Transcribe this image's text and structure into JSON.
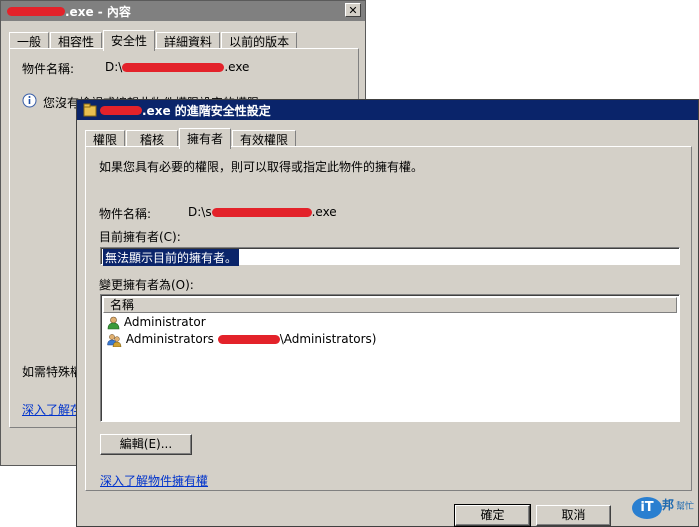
{
  "back_window": {
    "title": ".exe - 內容",
    "tabs": [
      "一般",
      "相容性",
      "安全性",
      "詳細資料",
      "以前的版本"
    ],
    "object_name_label": "物件名稱:",
    "object_name_prefix": "D:\\",
    "object_name_suffix": ".exe",
    "info_text": "您沒有檢視或編輯此物件權限設定的權限",
    "special_perms_text": "如需特殊權",
    "learn_more_link": "深入了解存"
  },
  "front_window": {
    "title": ".exe 的進階安全性設定",
    "tabs": [
      "權限",
      "稽核",
      "擁有者",
      "有效權限"
    ],
    "description": "如果您具有必要的權限，則可以取得或指定此物件的擁有權。",
    "object_name_label": "物件名稱:",
    "object_name_prefix": "D:\\s",
    "object_name_suffix": ".exe",
    "current_owner_label": "目前擁有者(C):",
    "current_owner_value": "無法顯示目前的擁有者。",
    "change_owner_label": "變更擁有者為(O):",
    "list_header_name": "名稱",
    "owners": [
      {
        "prefix": "Administrator",
        "suffix": ""
      },
      {
        "prefix": "Administrators ",
        "suffix": "\\Administrators)"
      }
    ],
    "edit_button": "編輯(E)...",
    "learn_more_link": "深入了解物件擁有權",
    "ok_button": "確定",
    "cancel_button": "取消"
  },
  "watermark": {
    "text1": "iT",
    "text2": "邦",
    "text3": "幫忙"
  },
  "colors": {
    "title_active": "#0a246a",
    "title_inactive": "#808080",
    "redaction": "#e3222a"
  }
}
